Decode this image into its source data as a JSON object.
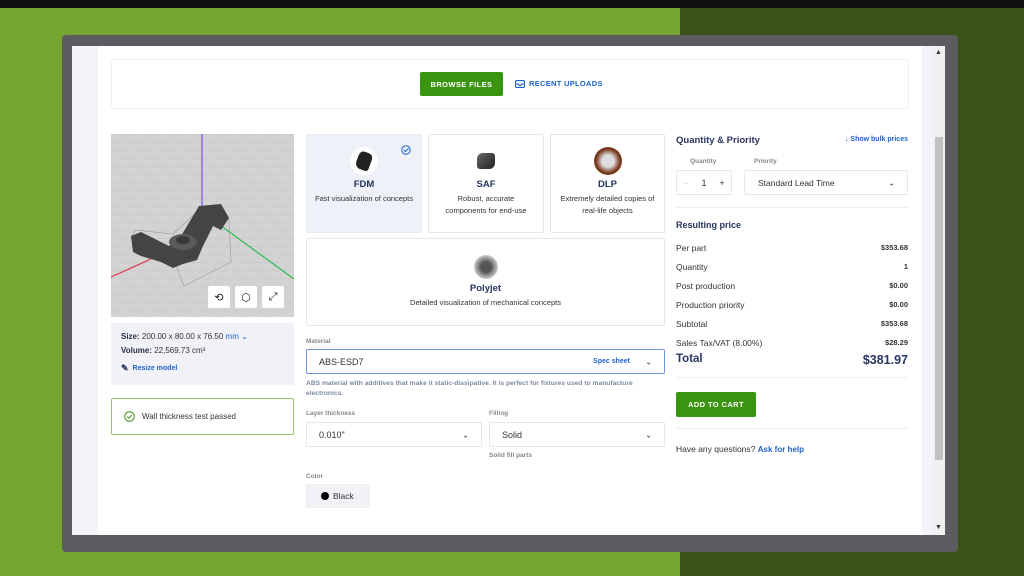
{
  "upload": {
    "browse_label": "BROWSE FILES",
    "recent_label": "RECENT UPLOADS"
  },
  "viewer": {
    "buttons": [
      "reset-view",
      "view-cube",
      "fullscreen"
    ]
  },
  "model": {
    "size_label": "Size:",
    "size_value": "200.00 x 80.00 x 76.50",
    "unit": "mm",
    "volume_label": "Volume:",
    "volume_value": "22,569.73 cm³",
    "resize_label": "Resize model"
  },
  "wall_check": "Wall thickness test passed",
  "technologies": [
    {
      "name": "FDM",
      "desc": "Fast visualization of concepts",
      "selected": true
    },
    {
      "name": "SAF",
      "desc": "Robust, accurate components for end-use"
    },
    {
      "name": "DLP",
      "desc": "Extremely detailed copies of real-life objects"
    },
    {
      "name": "Polyjet",
      "desc": "Detailed visualization of mechanical concepts"
    }
  ],
  "material": {
    "label": "Material",
    "value": "ABS-ESD7",
    "spec_sheet": "Spec sheet",
    "description": "ABS material with additives that make it static-dissipative. It is perfect for fixtures used to manufacture electronics."
  },
  "layer": {
    "label": "Layer thickness",
    "value": "0.010\""
  },
  "filling": {
    "label": "Filling",
    "value": "Solid",
    "hint": "Solid fill parts"
  },
  "color": {
    "label": "Color",
    "value": "Black",
    "swatch": "#000000"
  },
  "quantity_priority": {
    "title": "Quantity & Priority",
    "bulk_link": "Show bulk prices",
    "quantity_label": "Quantity",
    "quantity": "1",
    "priority_label": "Priority",
    "priority": "Standard Lead Time"
  },
  "price": {
    "title": "Resulting price",
    "rows": [
      {
        "label": "Per part",
        "value": "$353.68"
      },
      {
        "label": "Quantity",
        "value": "1"
      },
      {
        "label": "Post production",
        "value": "$0.00"
      },
      {
        "label": "Production priority",
        "value": "$0.00"
      },
      {
        "label": "Subtotal",
        "value": "$353.68"
      },
      {
        "label": "Sales Tax/VAT (8.00%)",
        "value": "$28.29"
      }
    ],
    "total_label": "Total",
    "total_value": "$381.97"
  },
  "cart_label": "ADD TO CART",
  "help": {
    "text": "Have any questions?",
    "link": "Ask for help"
  },
  "colors": {
    "accent_green": "#3b9410",
    "link_blue": "#1f62c9",
    "heading_navy": "#27355e"
  }
}
